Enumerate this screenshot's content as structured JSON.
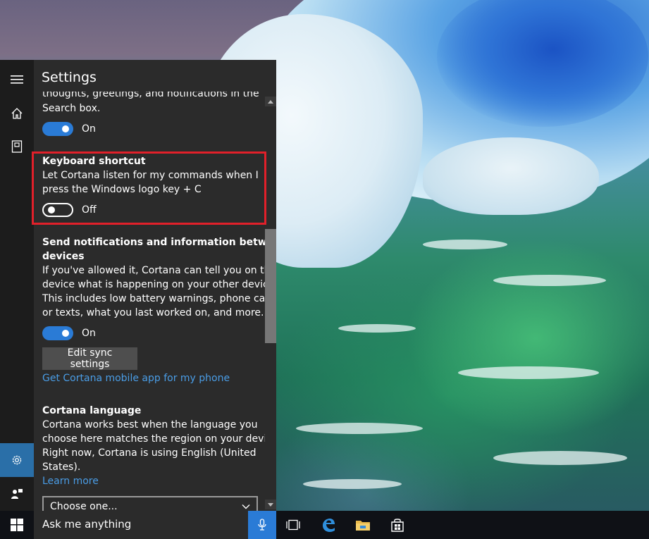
{
  "panel": {
    "title": "Settings"
  },
  "sections": {
    "partial_text_line1": "thoughts, greetings, and notifications in the",
    "partial_text_line2": "Search box.",
    "search_box_toggle_state": "On",
    "keyboard_shortcut": {
      "title": "Keyboard shortcut",
      "desc_line1": "Let Cortana listen for my commands when I",
      "desc_line2": "press the Windows logo key + C",
      "toggle_state": "Off"
    },
    "send_notifications": {
      "title_line1": "Send notifications and information between",
      "title_line2": "devices",
      "desc_line1": "If you've allowed it, Cortana can tell you on this",
      "desc_line2": "device what is happening on your other devices.",
      "desc_line3": "This includes low battery warnings, phone calls",
      "desc_line4": "or texts, what you last worked on, and more.",
      "toggle_state": "On",
      "edit_button": "Edit sync settings",
      "mobile_link": "Get Cortana mobile app for my phone"
    },
    "cortana_language": {
      "title": "Cortana language",
      "desc_line1": "Cortana works best when the language you",
      "desc_line2": "choose here matches the region on your device.",
      "desc_line3": "Right now, Cortana is using English (United",
      "desc_line4": "States).",
      "learn_more": "Learn more",
      "select_value": "Choose one..."
    }
  },
  "taskbar": {
    "search_placeholder": "Ask me anything"
  },
  "colors": {
    "accent": "#2a7bd6",
    "link": "#4a9de6",
    "highlight_border": "#e1202a",
    "panel_bg": "#2b2b2b",
    "rail_bg": "#1c1c1c"
  }
}
